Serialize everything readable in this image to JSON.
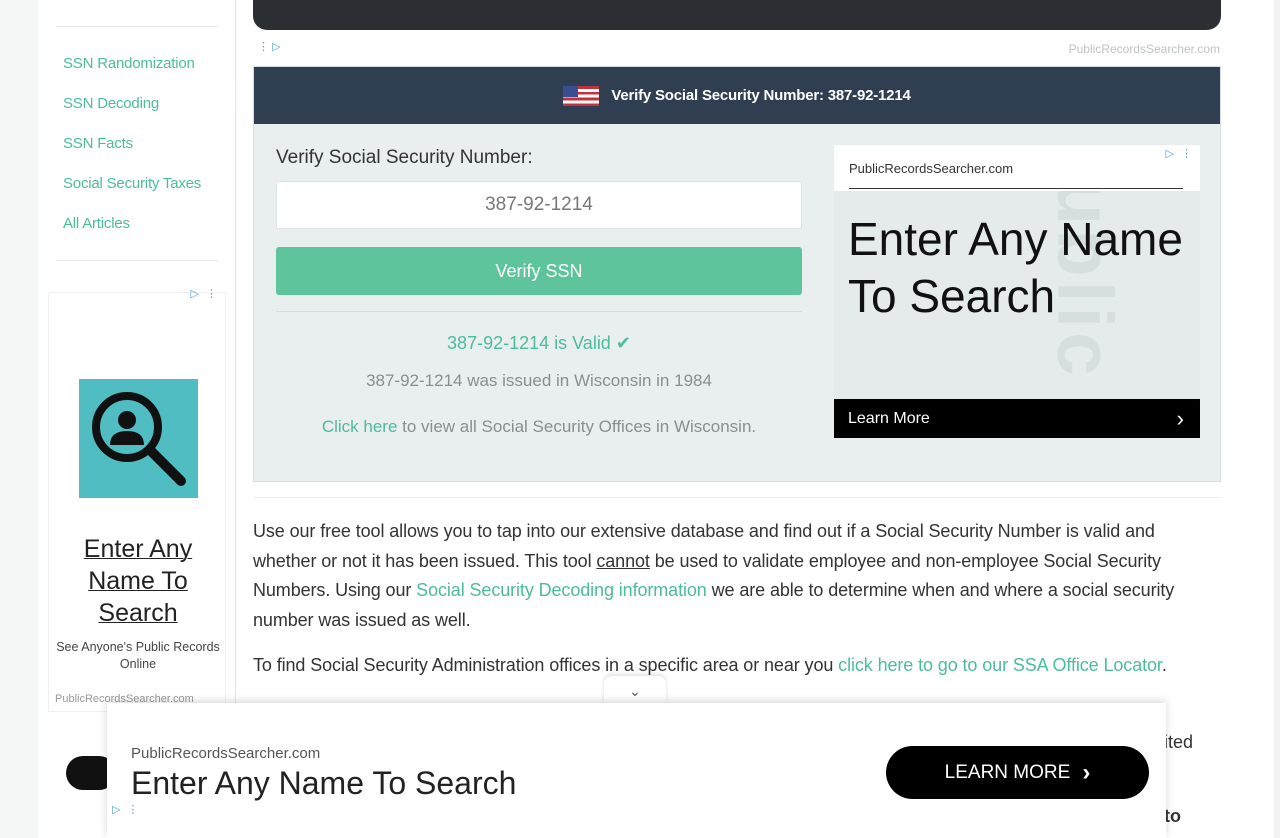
{
  "sidebar": {
    "links": [
      "SSN Randomization",
      "SSN Decoding",
      "SSN Facts",
      "Social Security Taxes",
      "All Articles"
    ],
    "ad": {
      "adchoice": "▷ ⋮",
      "title": "Enter Any Name To Search",
      "subtitle": "See Anyone's Public Records Online",
      "domain": "PublicRecordsSearcher.com"
    }
  },
  "top_ad": {
    "adchoice": "⋮ ▷",
    "domain": "PublicRecordsSearcher.com"
  },
  "panel": {
    "header": "Verify Social Security Number: 387-92-1214",
    "form_label": "Verify Social Security Number:",
    "ssn_value": "387-92-1214",
    "verify_button": "Verify SSN",
    "result_valid": "387-92-1214 is Valid",
    "result_check": "✔",
    "result_issued": "387-92-1214 was issued in Wisconsin in 1984",
    "offices_link": "Click here",
    "offices_text": " to view all Social Security Offices in Wisconsin."
  },
  "inline_ad": {
    "adchoice": "▷ ⋮",
    "domain": "PublicRecordsSearcher.com",
    "headline": "Enter Any Name To Search",
    "learn_more": "Learn More",
    "chevron": "›"
  },
  "content": {
    "p1_a": "Use our free tool allows you to tap into our extensive database and find out if a Social Security Number is valid and whether or not it has been issued. This tool ",
    "p1_cannot": "cannot",
    "p1_b": " be used to validate employee and non-employee Social Security Numbers. Using our ",
    "p1_link": "Social Security Decoding information",
    "p1_c": " we are able to determine when and where a social security number was issued as well.",
    "p2_a": "To find Social Security Administration offices in a specific area or near you ",
    "p2_link": "click here to go to our SSA Office Locator",
    "p2_b": ".",
    "tail_1": "ited",
    "tail_2": "to"
  },
  "sticky_ad": {
    "toggle": "⌄",
    "domain": "PublicRecordsSearcher.com",
    "headline": "Enter Any Name To Search",
    "cta": "LEARN MORE",
    "cta_chevron": "›",
    "adchoice": "▷ ⋮"
  }
}
